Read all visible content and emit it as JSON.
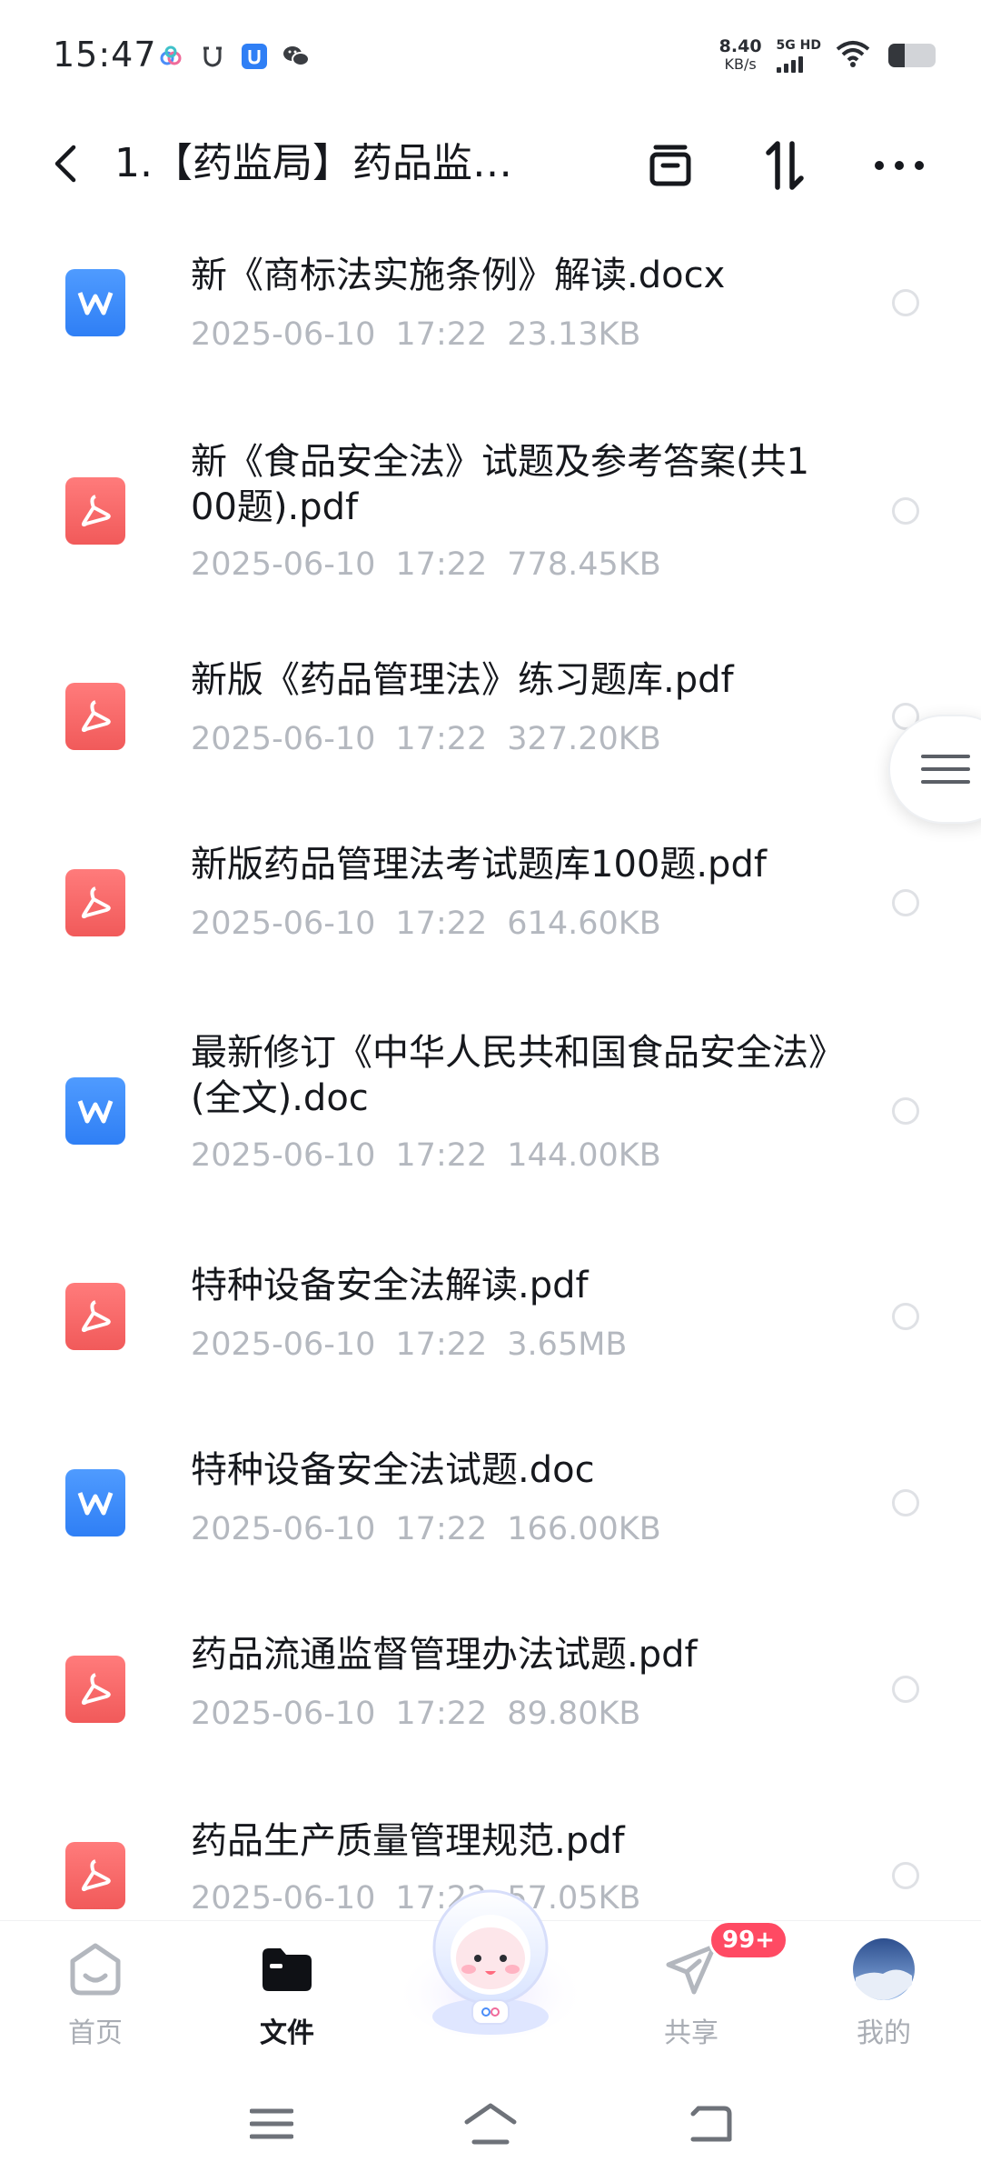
{
  "status_bar": {
    "time": "15:47",
    "net_speed_value": "8.40",
    "net_speed_unit": "KB/s",
    "signal_label": "5G HD",
    "battery_level": 0.35
  },
  "header": {
    "title": "1.【药监局】药品监…"
  },
  "files": [
    {
      "name": "新《商标法实施条例》解读.docx",
      "date": "2025-06-10",
      "time": "17:22",
      "size": "23.13KB",
      "type": "word"
    },
    {
      "name": "新《食品安全法》试题及参考答案(共100题).pdf",
      "date": "2025-06-10",
      "time": "17:22",
      "size": "778.45KB",
      "type": "pdf"
    },
    {
      "name": "新版《药品管理法》练习题库.pdf",
      "date": "2025-06-10",
      "time": "17:22",
      "size": "327.20KB",
      "type": "pdf"
    },
    {
      "name": "新版药品管理法考试题库100题.pdf",
      "date": "2025-06-10",
      "time": "17:22",
      "size": "614.60KB",
      "type": "pdf"
    },
    {
      "name": "最新修订《中华人民共和国食品安全法》(全文).doc",
      "date": "2025-06-10",
      "time": "17:22",
      "size": "144.00KB",
      "type": "word"
    },
    {
      "name": "特种设备安全法解读.pdf",
      "date": "2025-06-10",
      "time": "17:22",
      "size": "3.65MB",
      "type": "pdf"
    },
    {
      "name": "特种设备安全法试题.doc",
      "date": "2025-06-10",
      "time": "17:22",
      "size": "166.00KB",
      "type": "word"
    },
    {
      "name": "药品流通监督管理办法试题.pdf",
      "date": "2025-06-10",
      "time": "17:22",
      "size": "89.80KB",
      "type": "pdf"
    },
    {
      "name": "药品生产质量管理规范.pdf",
      "date": "2025-06-10",
      "time": "17:22",
      "size": "57.05KB",
      "type": "pdf"
    }
  ],
  "bottom_nav": {
    "home": "首页",
    "files": "文件",
    "share": "共享",
    "share_badge": "99+",
    "mine": "我的"
  },
  "colors": {
    "word_icon": "#3b8bff",
    "pdf_icon": "#f46464",
    "badge": "#ff4a63",
    "meta_text": "#b4b8bf"
  }
}
